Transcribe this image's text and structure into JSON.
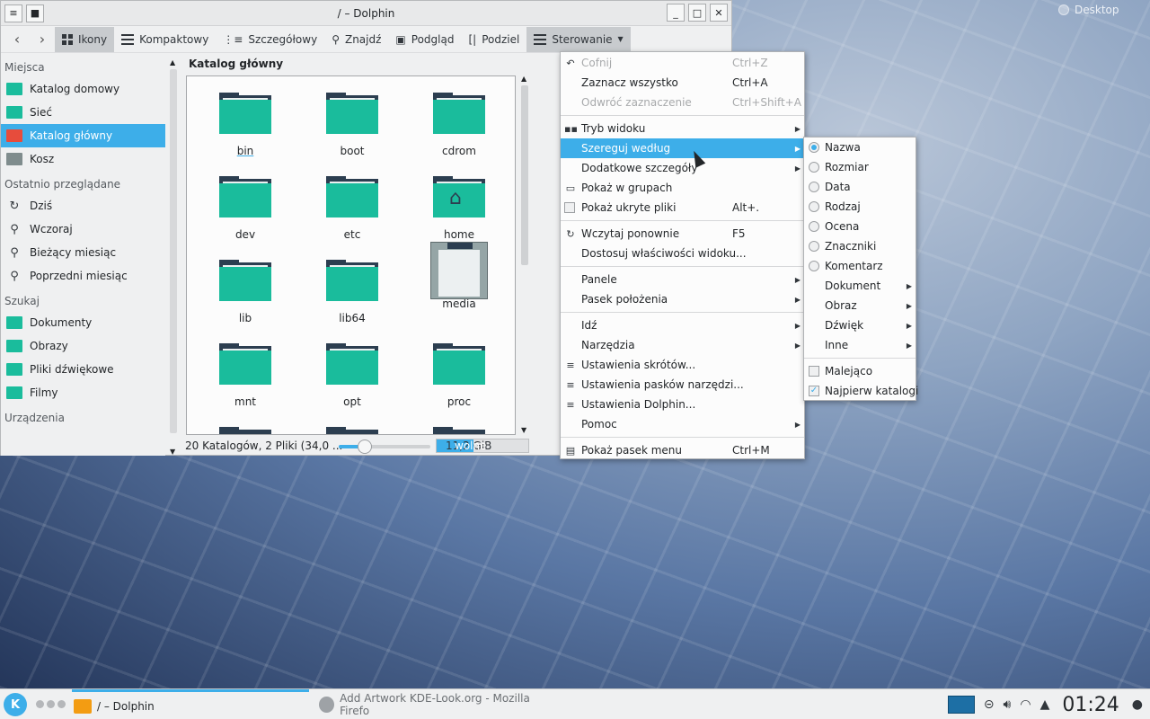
{
  "desktop": {
    "label": "Desktop"
  },
  "window": {
    "title": "/ – Dolphin",
    "menu_btn": "≡",
    "pin_btn": "■",
    "min": "_",
    "max": "□",
    "close": "✕"
  },
  "toolbar": {
    "back": "‹",
    "forward": "›",
    "ikony": "Ikony",
    "kompaktowy": "Kompaktowy",
    "szczegolowy": "Szczegółowy",
    "znajdz": "Znajdź",
    "podglad": "Podgląd",
    "podziel": "Podziel",
    "sterowanie": "Sterowanie"
  },
  "sidebar": {
    "sections": [
      {
        "title": "Miejsca",
        "items": [
          "Katalog domowy",
          "Sieć",
          "Katalog główny",
          "Kosz"
        ]
      },
      {
        "title": "Ostatnio przeglądane",
        "items": [
          "Dziś",
          "Wczoraj",
          "Bieżący miesiąc",
          "Poprzedni miesiąc"
        ]
      },
      {
        "title": "Szukaj",
        "items": [
          "Dokumenty",
          "Obrazy",
          "Pliki dźwiękowe",
          "Filmy"
        ]
      },
      {
        "title": "Urządzenia",
        "items": []
      }
    ]
  },
  "main": {
    "breadcrumb": "Katalog główny",
    "files": [
      "bin",
      "boot",
      "cdrom",
      "dev",
      "etc",
      "home",
      "lib",
      "lib64",
      "media",
      "mnt",
      "opt",
      "proc"
    ]
  },
  "status": {
    "summary": "20 Katalogów, 2 Pliki (34,0 ...",
    "free_label": "wolne",
    "free_value": "11,2 GiB",
    "zoom_fraction": 0.28,
    "used_fraction": 0.4
  },
  "menu_main": {
    "items": [
      {
        "label": "Cofnij",
        "shortcut": "Ctrl+Z"
      },
      {
        "label": "Zaznacz wszystko",
        "shortcut": "Ctrl+A"
      },
      {
        "label": "Odwróć zaznaczenie",
        "shortcut": "Ctrl+Shift+A"
      },
      {
        "label": "Tryb widoku"
      },
      {
        "label": "Szereguj według"
      },
      {
        "label": "Dodatkowe szczegóły"
      },
      {
        "label": "Pokaż w grupach"
      },
      {
        "label": "Pokaż ukryte pliki",
        "shortcut": "Alt+."
      },
      {
        "label": "Wczytaj ponownie",
        "shortcut": "F5"
      },
      {
        "label": "Dostosuj właściwości widoku..."
      },
      {
        "label": "Panele"
      },
      {
        "label": "Pasek położenia"
      },
      {
        "label": "Idź"
      },
      {
        "label": "Narzędzia"
      },
      {
        "label": "Ustawienia skrótów..."
      },
      {
        "label": "Ustawienia pasków narzędzi..."
      },
      {
        "label": "Ustawienia Dolphin..."
      },
      {
        "label": "Pomoc"
      },
      {
        "label": "Pokaż pasek menu",
        "shortcut": "Ctrl+M"
      }
    ]
  },
  "menu_sort": {
    "items": [
      "Nazwa",
      "Rozmiar",
      "Data",
      "Rodzaj",
      "Ocena",
      "Znaczniki",
      "Komentarz",
      "Dokument",
      "Obraz",
      "Dźwięk",
      "Inne",
      "Malejąco",
      "Najpierw katalogi"
    ]
  },
  "taskbar": {
    "k": "K",
    "dolphin": "/ – Dolphin",
    "firefox": "Add  Artwork KDE-Look.org - Mozilla Firefo",
    "clock": "01:24"
  }
}
